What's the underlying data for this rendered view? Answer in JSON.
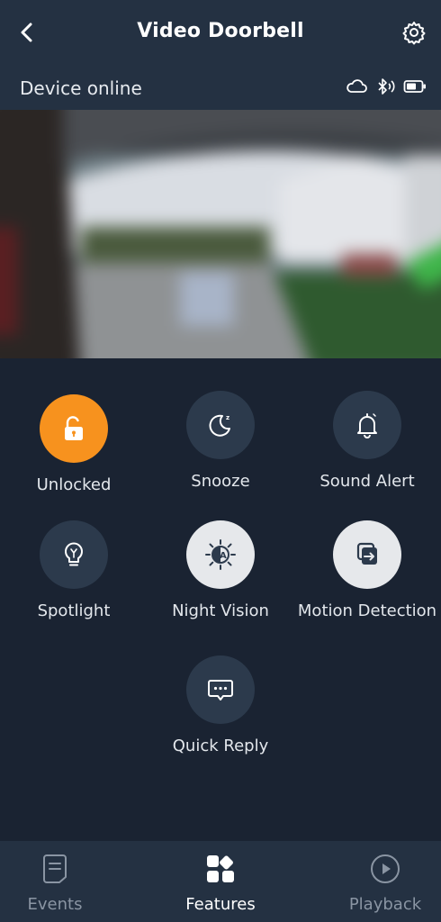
{
  "header": {
    "title": "Video Doorbell",
    "back_icon": "chevron-left-icon",
    "settings_icon": "gear-icon"
  },
  "status": {
    "text": "Device online",
    "icons": [
      "cloud-icon",
      "bluetooth-icon",
      "battery-icon"
    ]
  },
  "features": [
    {
      "id": "unlocked",
      "label": "Unlocked",
      "icon": "lock-open-icon",
      "state": "active",
      "color": "#f7921e"
    },
    {
      "id": "snooze",
      "label": "Snooze",
      "icon": "moon-icon",
      "state": "inactive"
    },
    {
      "id": "sound-alert",
      "label": "Sound Alert",
      "icon": "bell-icon",
      "state": "inactive"
    },
    {
      "id": "spotlight",
      "label": "Spotlight",
      "icon": "bulb-icon",
      "state": "inactive"
    },
    {
      "id": "night-vision",
      "label": "Night Vision",
      "icon": "night-vision-icon",
      "state": "enabled"
    },
    {
      "id": "motion-detection",
      "label": "Motion Detection",
      "icon": "motion-icon",
      "state": "enabled"
    },
    {
      "id": "quick-reply",
      "label": "Quick Reply",
      "icon": "chat-bubble-icon",
      "state": "inactive"
    }
  ],
  "nav": {
    "items": [
      {
        "label": "Events",
        "icon": "document-icon",
        "active": false
      },
      {
        "label": "Features",
        "icon": "grid-icon",
        "active": true
      },
      {
        "label": "Playback",
        "icon": "play-circle-icon",
        "active": false
      }
    ]
  },
  "colors": {
    "background": "#1a2332",
    "header": "#243142",
    "accent": "#f7921e"
  }
}
